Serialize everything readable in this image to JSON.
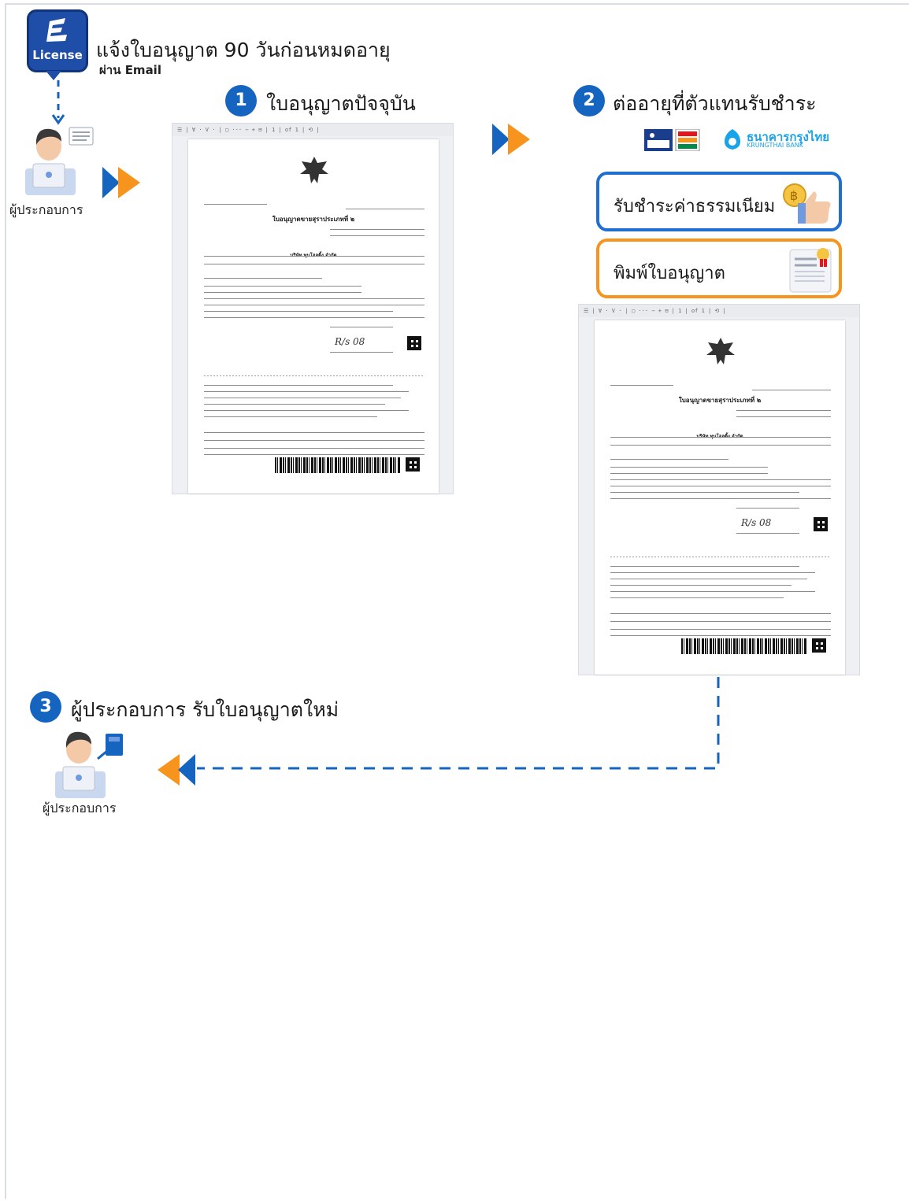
{
  "header": {
    "logo_text": "License",
    "title": "แจ้งใบอนุญาต 90 วันก่อนหมดอายุ",
    "subtitle": "ผ่าน Email"
  },
  "operator_label": "ผู้ประกอบการ",
  "step1": {
    "number": "1",
    "title": "ใบอนุญาตปัจจุบัน"
  },
  "step2": {
    "number": "2",
    "title": "ต่ออายุที่ตัวแทนรับชำระ",
    "bank_name_th": "ธนาคารกรุงไทย",
    "bank_name_en": "KRUNGTHAI BANK",
    "pay_label": "รับชำระค่าธรรมเนียม",
    "print_label": "พิมพ์ใบอนุญาต"
  },
  "step3": {
    "number": "3",
    "title": "ผู้ประกอบการ รับใบอนุญาตใหม่"
  },
  "document": {
    "toolbar": "☰ | ∀ · V · | ▢ ··· − + ⊟ | 1 | of 1 | ⟲ |",
    "title": "ใบอนุญาตขายสุราประเภทที่ ๒",
    "company": "บริษัท ทุนโฮลดิ้ง จำกัด",
    "signature": "R/s 08"
  },
  "colors": {
    "primary_blue": "#1565c0",
    "accent_orange": "#f7941d",
    "pay_border": "#1e6fd0",
    "print_border": "#f7941d"
  }
}
